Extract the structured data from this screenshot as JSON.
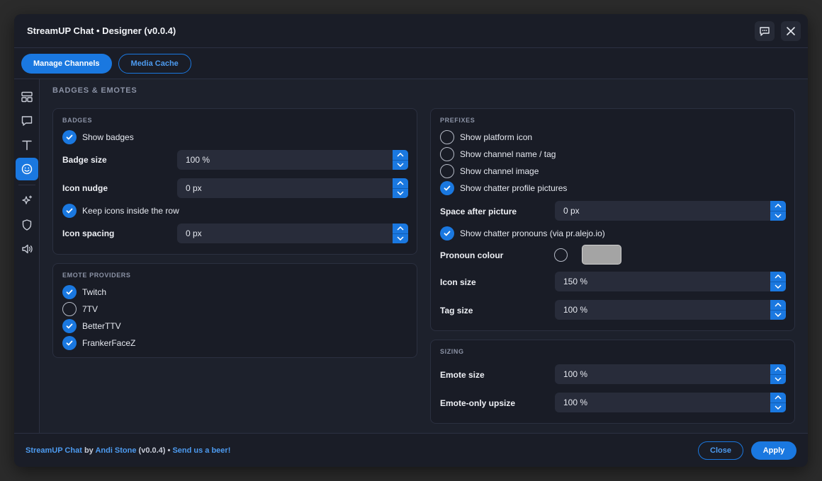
{
  "window": {
    "title": "StreamUP Chat • Designer (v0.0.4)"
  },
  "toolbar": {
    "manage_channels": "Manage Channels",
    "media_cache": "Media Cache"
  },
  "section": {
    "title": "BADGES & EMOTES"
  },
  "badges": {
    "title": "BADGES",
    "show_badges": {
      "label": "Show badges",
      "checked": true
    },
    "badge_size": {
      "label": "Badge size",
      "value": "100 %"
    },
    "icon_nudge": {
      "label": "Icon nudge",
      "value": "0 px"
    },
    "keep_inside": {
      "label": "Keep icons inside the row",
      "checked": true
    },
    "icon_spacing": {
      "label": "Icon spacing",
      "value": "0 px"
    }
  },
  "emote_providers": {
    "title": "EMOTE PROVIDERS",
    "items": [
      {
        "label": "Twitch",
        "checked": true
      },
      {
        "label": "7TV",
        "checked": false
      },
      {
        "label": "BetterTTV",
        "checked": true
      },
      {
        "label": "FrankerFaceZ",
        "checked": true
      }
    ]
  },
  "prefixes": {
    "title": "PREFIXES",
    "options": [
      {
        "label": "Show platform icon",
        "checked": false
      },
      {
        "label": "Show channel name / tag",
        "checked": false
      },
      {
        "label": "Show channel image",
        "checked": false
      },
      {
        "label": "Show chatter profile pictures",
        "checked": true
      }
    ],
    "space_after_picture": {
      "label": "Space after picture",
      "value": "0 px"
    },
    "pronouns": {
      "label": "Show chatter pronouns (via pr.alejo.io)",
      "checked": true
    },
    "pronoun_colour": {
      "label": "Pronoun colour",
      "enabled": false,
      "color": "#a4a4a4"
    },
    "icon_size": {
      "label": "Icon size",
      "value": "150 %"
    },
    "tag_size": {
      "label": "Tag size",
      "value": "100 %"
    }
  },
  "sizing": {
    "title": "SIZING",
    "emote_size": {
      "label": "Emote size",
      "value": "100 %"
    },
    "emote_only_upsize": {
      "label": "Emote-only upsize",
      "value": "100 %"
    }
  },
  "footer": {
    "app": "StreamUP Chat",
    "by": " by ",
    "author": "Andi Stone",
    "version": " (v0.0.4) • ",
    "beer": "Send us a beer!",
    "close": "Close",
    "apply": "Apply"
  },
  "colors": {
    "accent": "#1a78e0",
    "background": "#1b1e29",
    "card": "#191c26"
  },
  "icons": {
    "title_bar": [
      "chat-bubble-icon",
      "close-icon"
    ],
    "rail": [
      "layout-icon",
      "message-icon",
      "text-icon",
      "emoji-icon",
      "sparkle-icon",
      "shield-icon",
      "speaker-icon"
    ]
  }
}
